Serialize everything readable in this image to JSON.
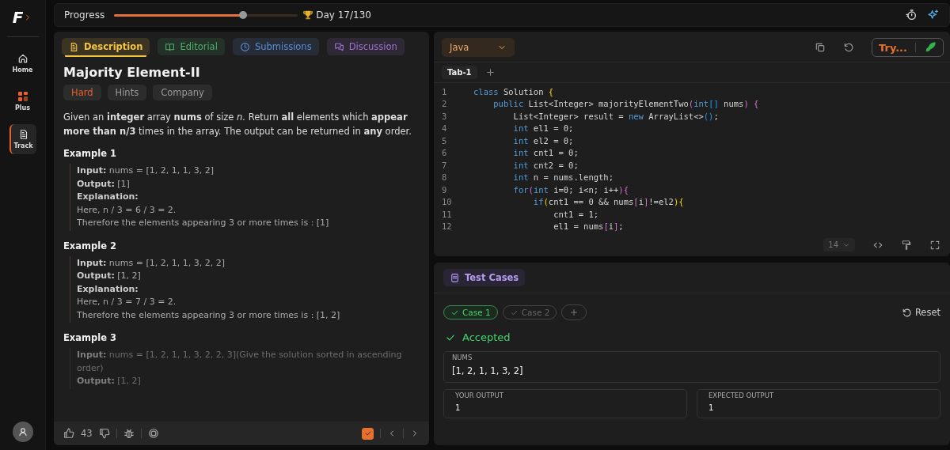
{
  "sidebar": {
    "logo": "F",
    "items": [
      {
        "label": "Home",
        "selected": false
      },
      {
        "label": "Plus",
        "selected": false
      },
      {
        "label": "Track",
        "selected": true
      }
    ]
  },
  "top_bar": {
    "label": "Progress",
    "level": 0.7,
    "day": "Day 17/130"
  },
  "problem": {
    "tabs": [
      {
        "label": "Description",
        "color": "#f5c542",
        "selected": true
      },
      {
        "label": "Editorial",
        "color": "#4caf6a",
        "selected": false
      },
      {
        "label": "Submissions",
        "color": "#5b8bd6",
        "selected": false
      },
      {
        "label": "Discussion",
        "color": "#9b72d0",
        "selected": false
      }
    ],
    "title": "Majority Element-II",
    "tags": [
      {
        "label": "Hard",
        "color": "#e8602c"
      },
      {
        "label": "Hints",
        "color": "#9a9a9a"
      },
      {
        "label": "Company",
        "color": "#9a9a9a"
      }
    ],
    "statement": "Given an **integer** array **nums** of size *n.* Return **all** elements which **appear more than n/3** times in the array. The output can be returned in **any** order.",
    "examples": [
      {
        "title": "Example 1",
        "faded": false,
        "lines": [
          "**Input:** nums = [1, 2, 1, 1, 3, 2]",
          "**Output:** [1]",
          "**Explanation:**",
          "Here, n / 3 = 6 / 3 = 2.",
          "Therefore the elements appearing 3 or more times is : [1]"
        ]
      },
      {
        "title": "Example 2",
        "faded": false,
        "lines": [
          "**Input:** nums = [1, 2, 1, 1, 3, 2, 2]",
          "**Output:** [1, 2]",
          "**Explanation:**",
          "Here, n / 3 = 7 / 3 = 2.",
          "Therefore the elements appearing 3 or more times is : [1, 2]"
        ]
      },
      {
        "title": "Example 3",
        "faded": true,
        "lines": [
          "**Input:** nums = [1, 2, 1, 1, 3, 2, 2, 3](Give the solution sorted in ascending order)",
          "**Output:**  [1, 2]"
        ]
      }
    ],
    "footer": {
      "likes": "43",
      "solved": true
    }
  },
  "editor": {
    "language": "Java",
    "run_button": "Try...",
    "tabs": [
      {
        "label": "Tab-1",
        "selected": true
      }
    ],
    "font_size": "14",
    "lines": [
      {
        "number": "1",
        "tokens": [
          {
            "t": "class",
            "kind": "kw"
          },
          {
            "t": " Solution ",
            "kind": "plain"
          },
          {
            "t": "{",
            "kind": "b1"
          }
        ]
      },
      {
        "number": "2",
        "tokens": [
          {
            "t": "    public",
            "kind": "kw"
          },
          {
            "t": " List<Integer> majorityElementTwo",
            "kind": "plain"
          },
          {
            "t": "(",
            "kind": "b2"
          },
          {
            "t": "int",
            "kind": "kw"
          },
          {
            "t": "[]",
            "kind": "b3"
          },
          {
            "t": " nums",
            "kind": "plain"
          },
          {
            "t": ") {",
            "kind": "b2"
          }
        ]
      },
      {
        "number": "3",
        "tokens": [
          {
            "t": "        List<Integer> result = ",
            "kind": "plain"
          },
          {
            "t": "new",
            "kind": "kw"
          },
          {
            "t": " ArrayList<>",
            "kind": "plain"
          },
          {
            "t": "()",
            "kind": "b3"
          },
          {
            "t": ";",
            "kind": "plain"
          }
        ]
      },
      {
        "number": "4",
        "tokens": [
          {
            "t": "        int",
            "kind": "kw"
          },
          {
            "t": " el1 = 0;",
            "kind": "plain"
          }
        ]
      },
      {
        "number": "5",
        "tokens": [
          {
            "t": "        int",
            "kind": "kw"
          },
          {
            "t": " el2 = 0;",
            "kind": "plain"
          }
        ]
      },
      {
        "number": "6",
        "tokens": [
          {
            "t": "        int",
            "kind": "kw"
          },
          {
            "t": " cnt1 = 0;",
            "kind": "plain"
          }
        ]
      },
      {
        "number": "7",
        "tokens": [
          {
            "t": "        int",
            "kind": "kw"
          },
          {
            "t": " cnt2 = 0;",
            "kind": "plain"
          }
        ]
      },
      {
        "number": "8",
        "tokens": [
          {
            "t": "        int",
            "kind": "kw"
          },
          {
            "t": " n = nums.length;",
            "kind": "plain"
          }
        ]
      },
      {
        "number": "9",
        "tokens": [
          {
            "t": "        for",
            "kind": "kw"
          },
          {
            "t": "(",
            "kind": "b2"
          },
          {
            "t": "int",
            "kind": "kw"
          },
          {
            "t": " i=0; i<n; i++",
            "kind": "plain"
          },
          {
            "t": "){",
            "kind": "b2"
          }
        ]
      },
      {
        "number": "10",
        "tokens": [
          {
            "t": "            if",
            "kind": "kw"
          },
          {
            "t": "(",
            "kind": "b1"
          },
          {
            "t": "cnt1 == 0 && nums",
            "kind": "plain"
          },
          {
            "t": "[",
            "kind": "b2"
          },
          {
            "t": "i",
            "kind": "plain"
          },
          {
            "t": "]",
            "kind": "b2"
          },
          {
            "t": "!=el2",
            "kind": "plain"
          },
          {
            "t": "){",
            "kind": "b1"
          }
        ]
      },
      {
        "number": "11",
        "tokens": [
          {
            "t": "                cnt1 = 1;",
            "kind": "plain"
          }
        ]
      },
      {
        "number": "12",
        "tokens": [
          {
            "t": "                el1 = nums",
            "kind": "plain"
          },
          {
            "t": "[",
            "kind": "b2"
          },
          {
            "t": "i",
            "kind": "plain"
          },
          {
            "t": "]",
            "kind": "b2"
          },
          {
            "t": ";",
            "kind": "plain"
          }
        ]
      }
    ]
  },
  "tests": {
    "tab": "Test Cases",
    "reset": "Reset",
    "cases": [
      {
        "label": "Case 1",
        "selected": true
      },
      {
        "label": "Case 2",
        "selected": false
      }
    ],
    "verdict": "Accepted",
    "input": {
      "label": "NUMS",
      "value": "[1, 2, 1, 1, 3, 2]"
    },
    "outputs": [
      {
        "label": "YOUR OUTPUT",
        "value": "1"
      },
      {
        "label": "EXPECTED OUTPUT",
        "value": "1"
      }
    ]
  }
}
